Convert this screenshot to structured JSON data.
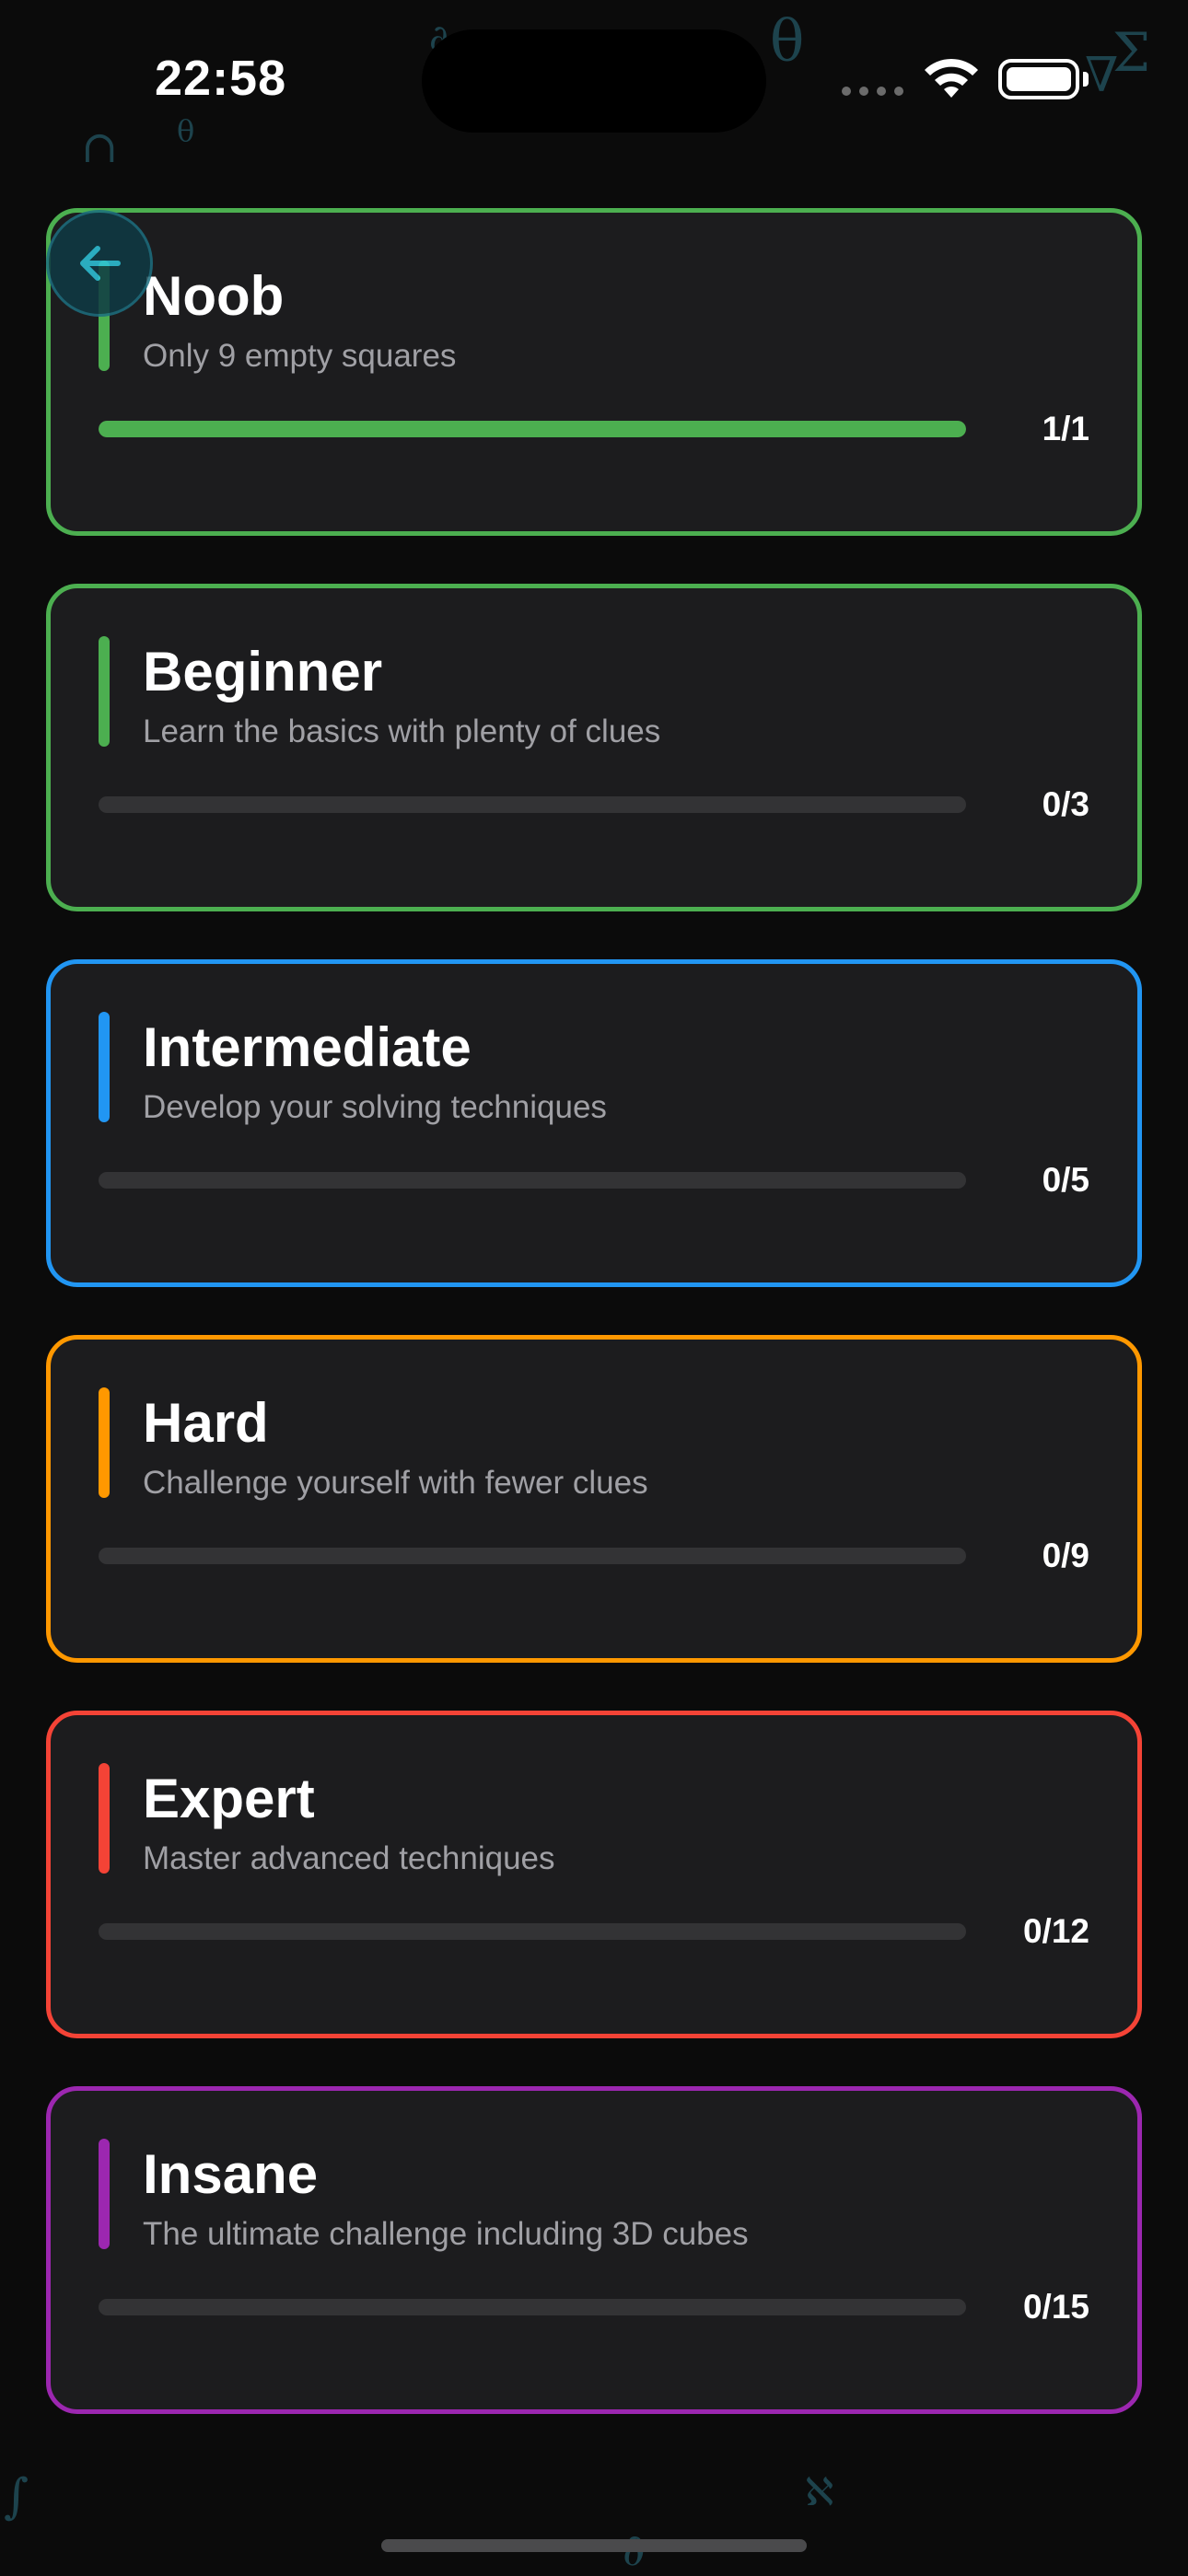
{
  "status_bar": {
    "time": "22:58"
  },
  "decorations": [
    "∂",
    "θ",
    "Σ",
    "∇",
    "∩",
    "θ",
    "∫",
    "ℵ",
    "∂"
  ],
  "back_button": {
    "icon": "arrow-left-icon",
    "color": "#2ec6dc"
  },
  "levels": [
    {
      "title": "Noob",
      "subtitle": "Only 9 empty squares",
      "progress_label": "1/1",
      "completed": 1,
      "total": 1,
      "color": "#4caf50"
    },
    {
      "title": "Beginner",
      "subtitle": "Learn the basics with plenty of clues",
      "progress_label": "0/3",
      "completed": 0,
      "total": 3,
      "color": "#4caf50"
    },
    {
      "title": "Intermediate",
      "subtitle": "Develop your solving techniques",
      "progress_label": "0/5",
      "completed": 0,
      "total": 5,
      "color": "#2196f3"
    },
    {
      "title": "Hard",
      "subtitle": "Challenge yourself with fewer clues",
      "progress_label": "0/9",
      "completed": 0,
      "total": 9,
      "color": "#ff9800"
    },
    {
      "title": "Expert",
      "subtitle": "Master advanced techniques",
      "progress_label": "0/12",
      "completed": 0,
      "total": 12,
      "color": "#f44336"
    },
    {
      "title": "Insane",
      "subtitle": "The ultimate challenge including 3D cubes",
      "progress_label": "0/15",
      "completed": 0,
      "total": 15,
      "color": "#9c27b0"
    }
  ]
}
